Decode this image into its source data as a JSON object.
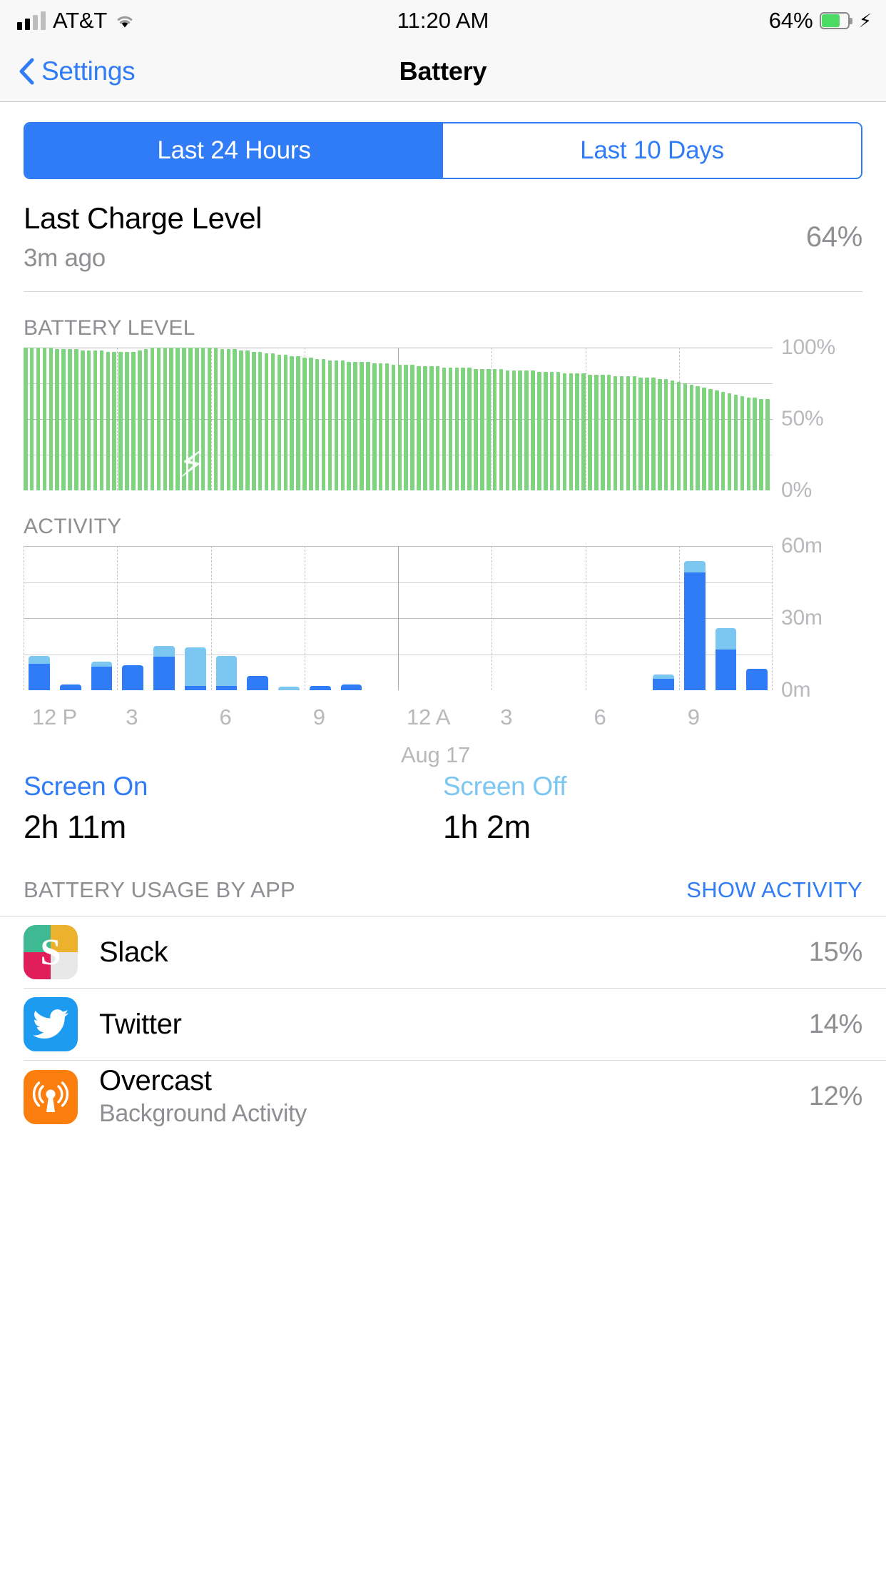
{
  "status_bar": {
    "carrier": "AT&T",
    "time": "11:20 AM",
    "battery_percent": "64%",
    "signal_bars_filled": 2,
    "wifi_icon": "wifi-icon",
    "charging_icon": "lightning-bolt-icon",
    "battery_fill_color": "#4cd964"
  },
  "nav": {
    "back_label": "Settings",
    "title": "Battery",
    "back_icon": "chevron-left-icon",
    "tint_color": "#2f7cf6"
  },
  "segmented": {
    "options": [
      "Last 24 Hours",
      "Last 10 Days"
    ],
    "selected_index": 0
  },
  "last_charge": {
    "title": "Last Charge Level",
    "subtitle": "3m ago",
    "value": "64%"
  },
  "battery_section_label": "BATTERY LEVEL",
  "activity_section_label": "ACTIVITY",
  "screen_stats": {
    "on_label": "Screen On",
    "on_value": "2h 11m",
    "off_label": "Screen Off",
    "off_value": "1h 2m",
    "on_color": "#2f7cf6",
    "off_color": "#7cc6f2"
  },
  "usage": {
    "header": "BATTERY USAGE BY APP",
    "action": "SHOW ACTIVITY",
    "apps": [
      {
        "name": "Slack",
        "subtitle": "",
        "percent": "15%",
        "icon": "slack-app-icon"
      },
      {
        "name": "Twitter",
        "subtitle": "",
        "percent": "14%",
        "icon": "twitter-app-icon"
      },
      {
        "name": "Overcast",
        "subtitle": "Background Activity",
        "percent": "12%",
        "icon": "overcast-app-icon"
      }
    ]
  },
  "chart_data": [
    {
      "type": "bar",
      "id": "battery-level",
      "title": "BATTERY LEVEL",
      "ylabel": "",
      "ylim": [
        0,
        100
      ],
      "ytick_labels": [
        "0%",
        "50%",
        "100%"
      ],
      "ytick_values": [
        0,
        50,
        100
      ],
      "gridlines": [
        0,
        25,
        50,
        75,
        100
      ],
      "bar_color": "#7ed37f",
      "annotation": {
        "label": "charging",
        "icon": "lightning-bolt-icon",
        "x_index": 26,
        "y_value": 18
      },
      "values": [
        100,
        100,
        100,
        100,
        100,
        99,
        99,
        99,
        99,
        98,
        98,
        98,
        98,
        97,
        97,
        97,
        97,
        97,
        98,
        99,
        100,
        100,
        100,
        100,
        100,
        100,
        100,
        100,
        100,
        100,
        100,
        99,
        99,
        99,
        98,
        98,
        97,
        97,
        96,
        96,
        95,
        95,
        94,
        94,
        93,
        93,
        92,
        92,
        91,
        91,
        91,
        90,
        90,
        90,
        90,
        89,
        89,
        89,
        88,
        88,
        88,
        88,
        87,
        87,
        87,
        87,
        86,
        86,
        86,
        86,
        86,
        85,
        85,
        85,
        85,
        85,
        84,
        84,
        84,
        84,
        84,
        83,
        83,
        83,
        83,
        82,
        82,
        82,
        82,
        81,
        81,
        81,
        81,
        80,
        80,
        80,
        80,
        79,
        79,
        79,
        78,
        78,
        77,
        76,
        75,
        74,
        73,
        72,
        71,
        70,
        69,
        68,
        67,
        66,
        65,
        65,
        64,
        64
      ]
    },
    {
      "type": "bar",
      "id": "activity",
      "title": "ACTIVITY",
      "stacked": true,
      "ylabel": "",
      "ylim": [
        0,
        60
      ],
      "ytick_labels": [
        "0m",
        "30m",
        "60m"
      ],
      "ytick_values": [
        0,
        30,
        60
      ],
      "gridlines": [
        0,
        15,
        30,
        45,
        60
      ],
      "xtick_labels": [
        "12 P",
        "3",
        "6",
        "9",
        "12 A",
        "3",
        "6",
        "9"
      ],
      "xtick_positions": [
        0,
        3,
        6,
        9,
        12,
        15,
        18,
        21
      ],
      "date_annotation": "Aug 17",
      "series": [
        {
          "name": "Screen On",
          "color": "#2f7cf6",
          "values": [
            11,
            2.5,
            10,
            10.5,
            14,
            2,
            2,
            6,
            0,
            2,
            2.5,
            0,
            0,
            0,
            0,
            0,
            0,
            0,
            0,
            0,
            5,
            49,
            17,
            9
          ]
        },
        {
          "name": "Screen Off",
          "color": "#7cc6f2",
          "values": [
            3.5,
            0,
            2,
            0,
            4.5,
            16,
            12.5,
            0,
            1.5,
            0,
            0,
            0,
            0,
            0,
            0,
            0,
            0,
            0,
            0,
            0,
            1.5,
            5,
            9,
            0
          ]
        }
      ]
    }
  ]
}
